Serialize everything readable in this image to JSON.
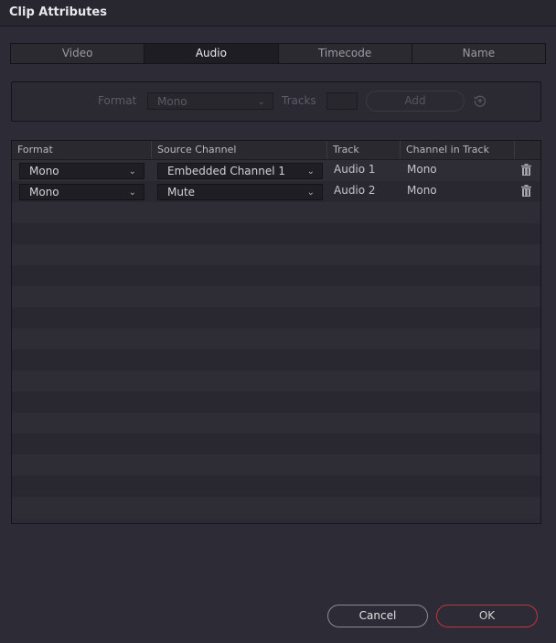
{
  "window": {
    "title": "Clip Attributes"
  },
  "tabs": [
    {
      "label": "Video",
      "active": false
    },
    {
      "label": "Audio",
      "active": true
    },
    {
      "label": "Timecode",
      "active": false
    },
    {
      "label": "Name",
      "active": false
    }
  ],
  "add_panel": {
    "format_label": "Format",
    "format_value": "Mono",
    "tracks_label": "Tracks",
    "tracks_value": "",
    "add_label": "Add",
    "reset_icon": "reset-icon"
  },
  "table": {
    "columns": [
      "Format",
      "Source Channel",
      "Track",
      "Channel in Track",
      ""
    ],
    "rows": [
      {
        "format": "Mono",
        "source_channel": "Embedded Channel 1",
        "track": "Audio 1",
        "channel_in_track": "Mono"
      },
      {
        "format": "Mono",
        "source_channel": "Mute",
        "track": "Audio 2",
        "channel_in_track": "Mono"
      }
    ]
  },
  "footer": {
    "cancel_label": "Cancel",
    "ok_label": "OK"
  },
  "colors": {
    "ok_border": "#c0353c",
    "background": "#2d2c36"
  }
}
